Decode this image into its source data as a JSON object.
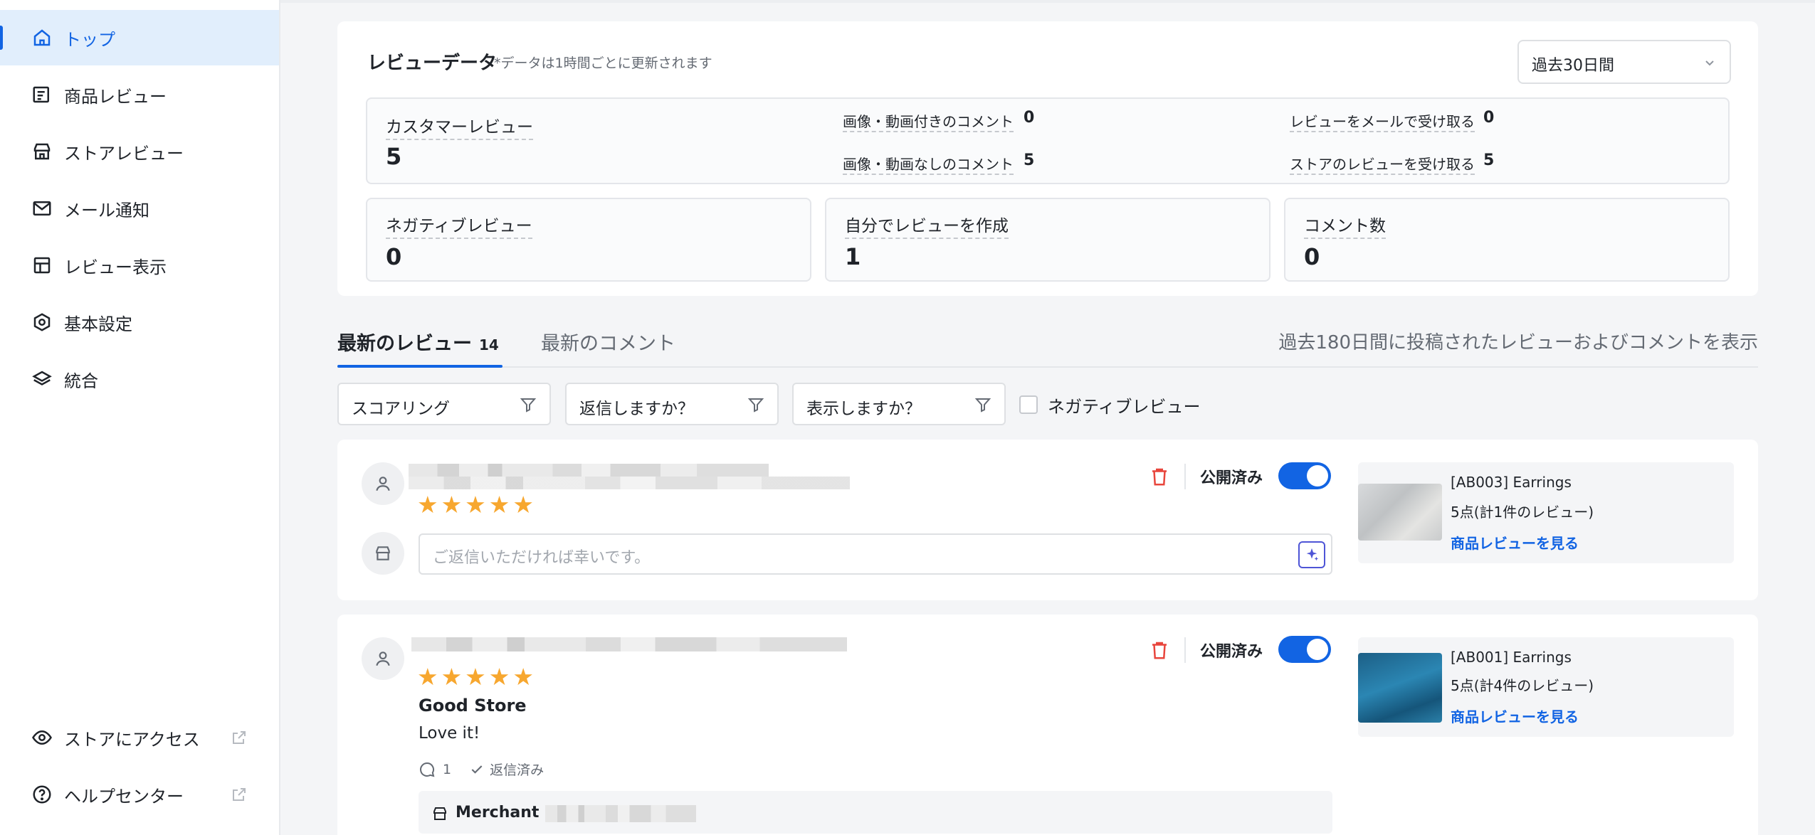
{
  "sidebar": {
    "items": [
      {
        "label": "トップ",
        "icon": "home-icon"
      },
      {
        "label": "商品レビュー",
        "icon": "product-review-icon"
      },
      {
        "label": "ストアレビュー",
        "icon": "store-icon"
      },
      {
        "label": "メール通知",
        "icon": "mail-icon"
      },
      {
        "label": "レビュー表示",
        "icon": "layout-icon"
      },
      {
        "label": "基本設定",
        "icon": "settings-icon"
      },
      {
        "label": "統合",
        "icon": "layers-icon"
      }
    ],
    "footer": [
      {
        "label": "ストアにアクセス",
        "icon": "eye-icon"
      },
      {
        "label": "ヘルプセンター",
        "icon": "help-icon"
      }
    ]
  },
  "review_data": {
    "title": "レビューデータ",
    "subtitle": "*データは1時間ごとに更新されます",
    "period": "過去30日間",
    "customer_reviews": {
      "label": "カスタマーレビュー",
      "value": "5"
    },
    "with_media": {
      "label": "画像・動画付きのコメント",
      "value": "0"
    },
    "without_media": {
      "label": "画像・動画なしのコメント",
      "value": "5"
    },
    "via_email": {
      "label": "レビューをメールで受け取る",
      "value": "0"
    },
    "store_reviews": {
      "label": "ストアのレビューを受け取る",
      "value": "5"
    },
    "negative": {
      "label": "ネガティブレビュー",
      "value": "0"
    },
    "self_created": {
      "label": "自分でレビューを作成",
      "value": "1"
    },
    "comments": {
      "label": "コメント数",
      "value": "0"
    }
  },
  "tabs": {
    "latest_reviews": "最新のレビュー",
    "latest_reviews_count": "14",
    "latest_comments": "最新のコメント",
    "note": "過去180日間に投稿されたレビューおよびコメントを表示"
  },
  "filters": {
    "scoring": "スコアリング",
    "replied": "返信しますか？",
    "displayed": "表示しますか？",
    "negative_checkbox": "ネガティブレビュー"
  },
  "reviews": [
    {
      "rating": 5,
      "stars": "★★★★★",
      "status": "公開済み",
      "reply_placeholder": "ご返信いただければ幸いです。",
      "product": {
        "name": "[AB003] Earrings",
        "rating": "5点(計1件のレビュー)",
        "link": "商品レビューを見る"
      }
    },
    {
      "rating": 5,
      "stars": "★★★★★",
      "status": "公開済み",
      "title": "Good Store",
      "body": "Love it!",
      "comment_count": "1",
      "replied": "返信済み",
      "merchant": "Merchant",
      "product": {
        "name": "[AB001] Earrings",
        "rating": "5点(計4件のレビュー)",
        "link": "商品レビューを見る"
      }
    }
  ],
  "colors": {
    "accent": "#1264e3",
    "star": "#f7a72f",
    "danger": "#e8453c"
  }
}
